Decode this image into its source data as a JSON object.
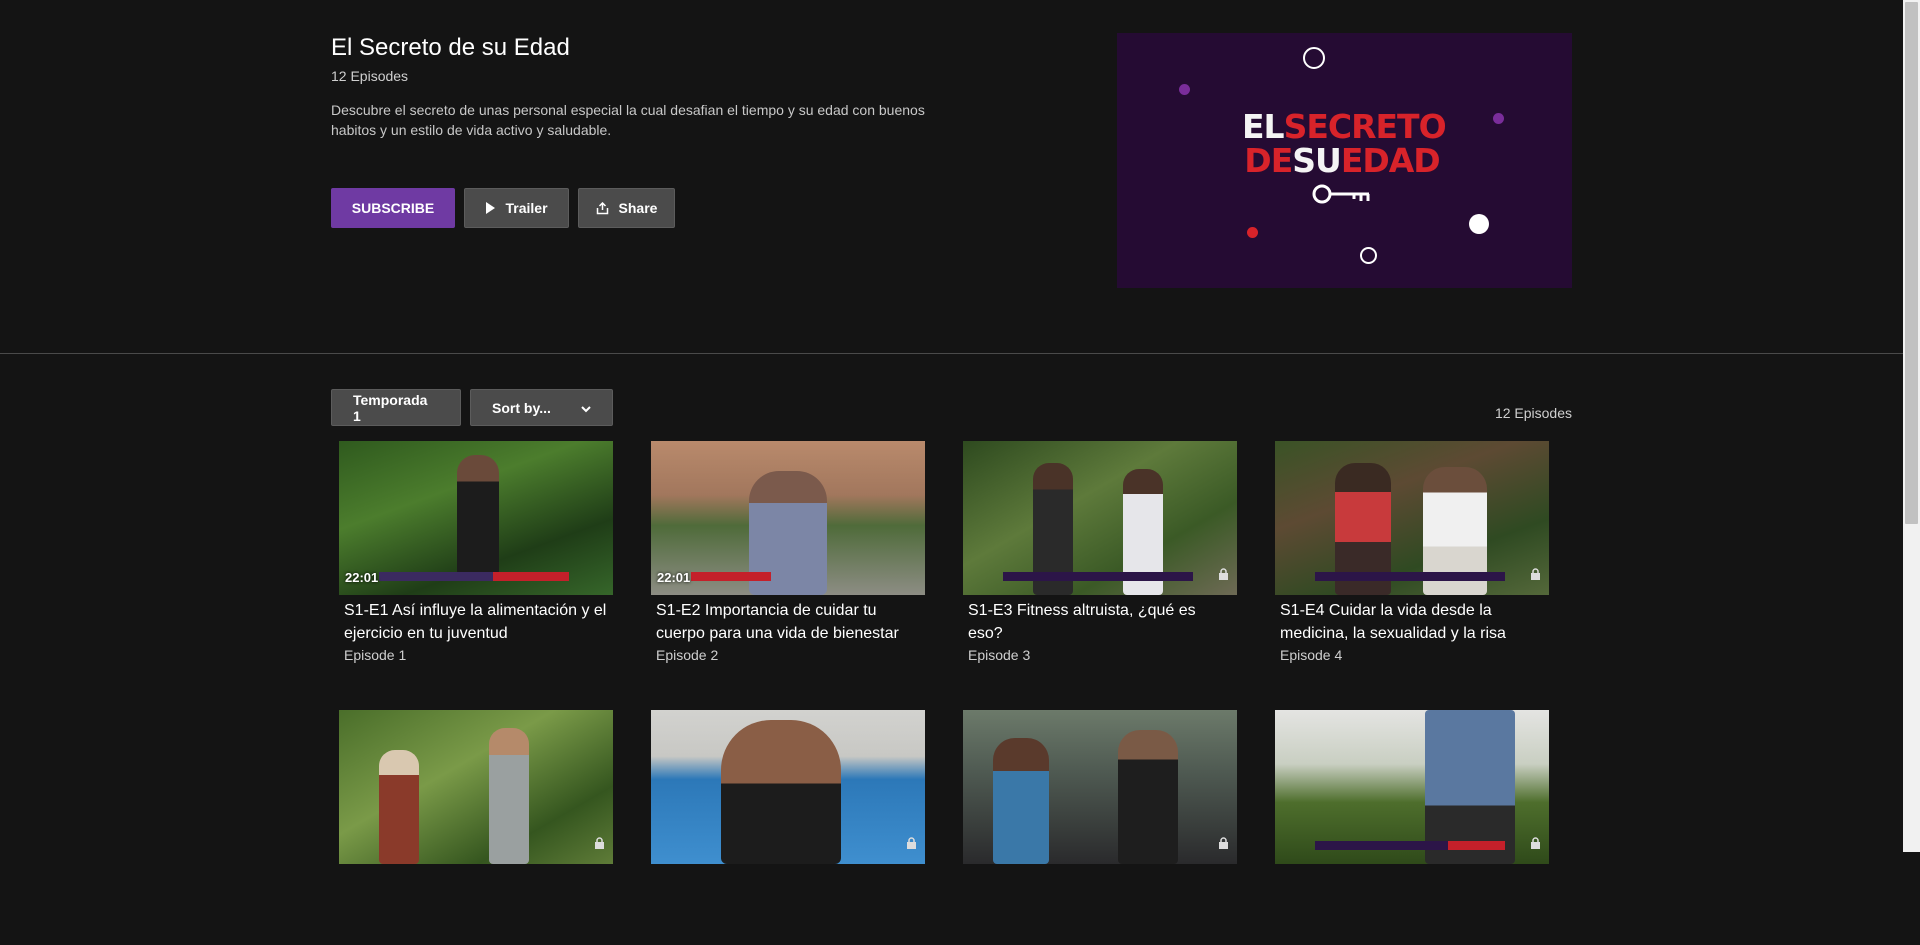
{
  "show": {
    "title": "El Secreto de su Edad",
    "episode_count": "12 Episodes",
    "description": "Descubre el secreto de unas personal especial la cual desafian el tiempo y su edad con buenos habitos y un estilo de vida activo y saludable."
  },
  "actions": {
    "subscribe": "SUBSCRIBE",
    "trailer": "Trailer",
    "share": "Share"
  },
  "poster": {
    "line1_a": "EL",
    "line1_b": "SECRETO",
    "line2_a": "DE",
    "line2_b": "SU",
    "line2_c": "EDAD",
    "colors": {
      "background": "#250b33",
      "accent_red": "#d8232a",
      "accent_purple": "#7a2d9a"
    }
  },
  "filters": {
    "season": "Temporada 1",
    "sort": "Sort by..."
  },
  "total_episodes": "12 Episodes",
  "episodes": [
    {
      "title": "S1-E1 Así influye la alimentación y el ejercicio en tu juventud",
      "sub": "Episode 1",
      "duration": "22:01",
      "locked": false
    },
    {
      "title": "S1-E2 Importancia de cuidar tu cuerpo para una vida de bienestar",
      "sub": "Episode 2",
      "duration": "22:01",
      "locked": false
    },
    {
      "title": "S1-E3 Fitness altruista, ¿qué es eso?",
      "sub": "Episode 3",
      "duration": "",
      "locked": true
    },
    {
      "title": "S1-E4 Cuidar la vida desde la medicina, la sexualidad y la risa",
      "sub": "Episode 4",
      "duration": "",
      "locked": true
    },
    {
      "title": "",
      "sub": "",
      "duration": "",
      "locked": true
    },
    {
      "title": "",
      "sub": "",
      "duration": "",
      "locked": true
    },
    {
      "title": "",
      "sub": "",
      "duration": "",
      "locked": true
    },
    {
      "title": "",
      "sub": "",
      "duration": "",
      "locked": true
    }
  ],
  "colors": {
    "subscribe": "#6f3aa3",
    "page_bg": "#141414",
    "button_gray": "#4b4b4b"
  },
  "icons": [
    "play-icon",
    "share-icon",
    "chevron-down-icon",
    "lock-icon"
  ]
}
